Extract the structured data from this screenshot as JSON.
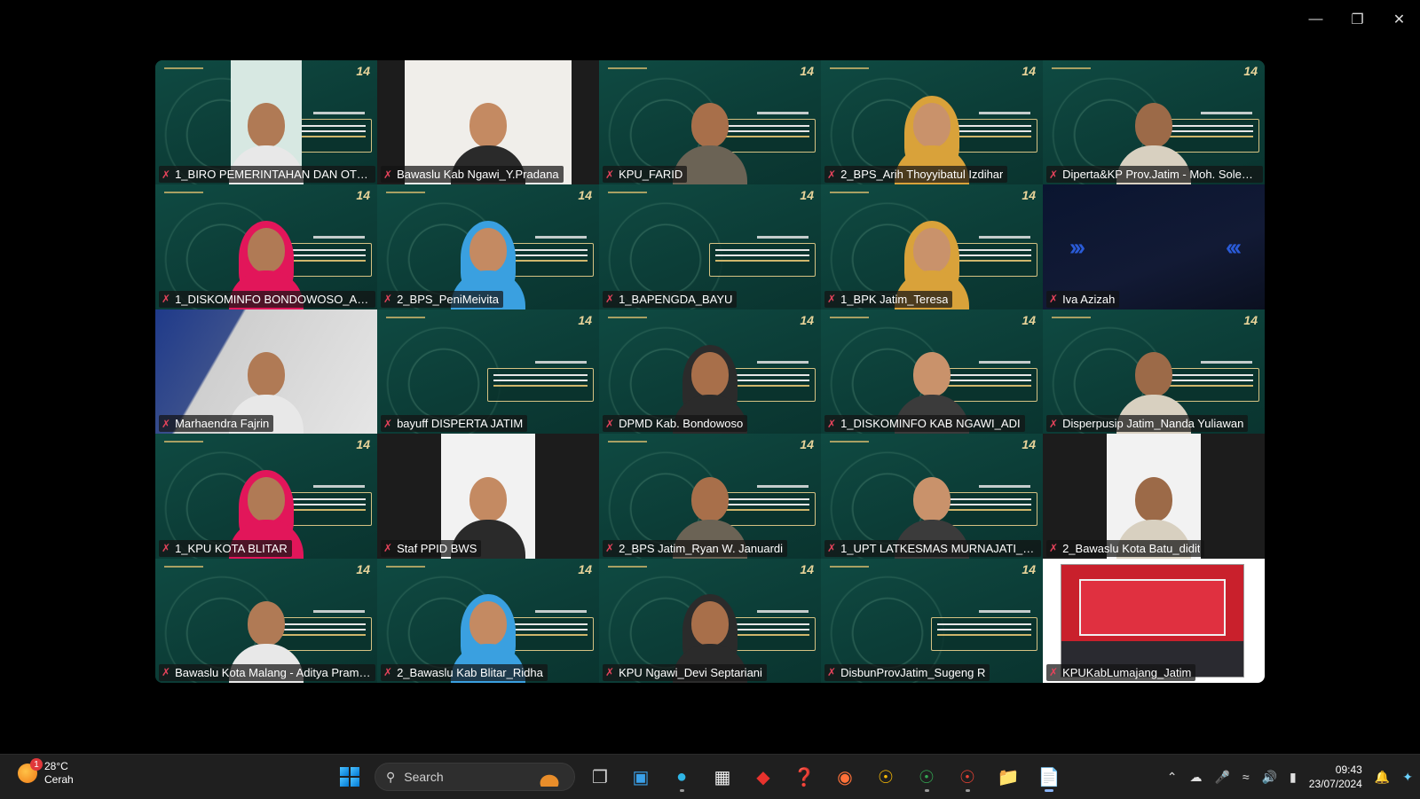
{
  "window": {
    "controls": {
      "minimize": "—",
      "restore": "❐",
      "close": "✕"
    }
  },
  "participants": [
    {
      "name": "1_BIRO PEMERINTAHAN DAN OTON...",
      "bg": "green-narrow-cam"
    },
    {
      "name": "Bawaslu Kab Ngawi_Y.Pradana",
      "bg": "room-cam"
    },
    {
      "name": "KPU_FARID",
      "bg": "green"
    },
    {
      "name": "2_BPS_Arih Thoyyibatul Izdihar",
      "bg": "green"
    },
    {
      "name": "Diperta&KP Prov.Jatim - Moh. Soleho...",
      "bg": "green"
    },
    {
      "name": "1_DISKOMINFO BONDOWOSO_ANN...",
      "bg": "green"
    },
    {
      "name": "2_BPS_PeniMeivita",
      "bg": "green"
    },
    {
      "name": "1_BAPENGDA_BAYU",
      "bg": "green"
    },
    {
      "name": "1_BPK Jatim_Teresa",
      "bg": "green"
    },
    {
      "name": "Iva Azizah",
      "bg": "dark-blue"
    },
    {
      "name": "Marhaendra Fajrin",
      "bg": "room"
    },
    {
      "name": "bayuff DISPERTA JATIM",
      "bg": "green"
    },
    {
      "name": "DPMD Kab. Bondowoso",
      "bg": "green"
    },
    {
      "name": "1_DISKOMINFO KAB NGAWI_ADI",
      "bg": "green"
    },
    {
      "name": "Disperpusip Jatim_Nanda Yuliawan",
      "bg": "green"
    },
    {
      "name": "1_KPU KOTA BLITAR",
      "bg": "green"
    },
    {
      "name": "Staf PPID BWS",
      "bg": "narrow-cam"
    },
    {
      "name": "2_BPS Jatim_Ryan W. Januardi",
      "bg": "green"
    },
    {
      "name": "1_UPT LATKESMAS MURNAJATI_Her...",
      "bg": "green"
    },
    {
      "name": "2_Bawaslu Kota Batu_didit",
      "bg": "narrow-cam"
    },
    {
      "name": "Bawaslu Kota Malang - Aditya Pramo...",
      "bg": "green"
    },
    {
      "name": "2_Bawaslu Kab Blitar_Ridha",
      "bg": "green"
    },
    {
      "name": "KPU Ngawi_Devi Septariani",
      "bg": "green"
    },
    {
      "name": "DisbunProvJatim_Sugeng R",
      "bg": "green"
    },
    {
      "name": "KPUKabLumajang_Jatim",
      "bg": "screen-share"
    }
  ],
  "virtual_background": {
    "badge": "14"
  },
  "taskbar": {
    "weather": {
      "temp": "28°C",
      "condition": "Cerah",
      "alert_count": "1"
    },
    "search_placeholder": "Search",
    "clock": {
      "time": "09:43",
      "date": "23/07/2024"
    }
  },
  "colors": {
    "mic_muted": "#e6435b",
    "tile_green": "#0d3b35",
    "taskbar": "#1f1f1f"
  }
}
